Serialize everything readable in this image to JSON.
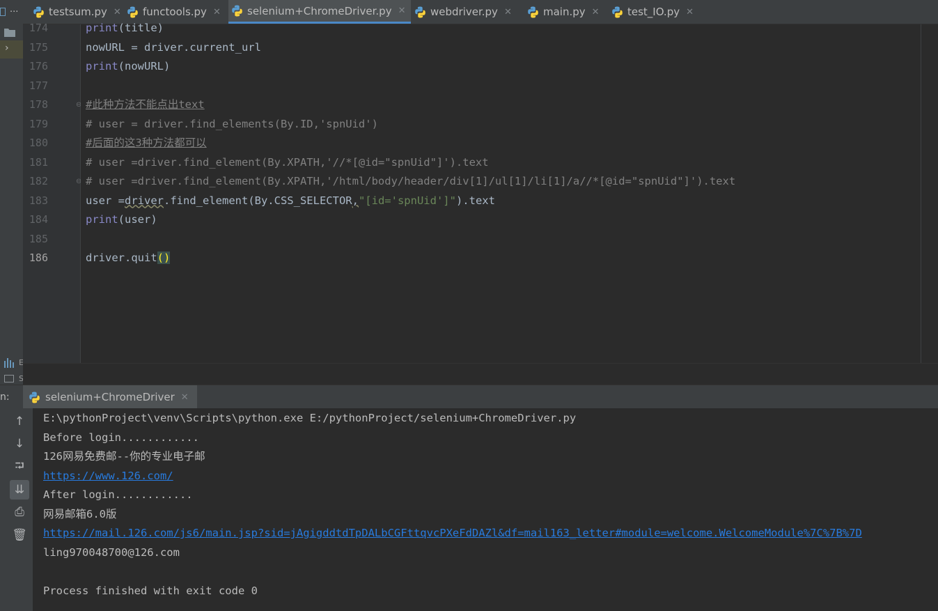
{
  "left_strip": {
    "project_label": "...",
    "bottom_letter_1": "E",
    "bottom_letter_2": "S"
  },
  "tabs": [
    {
      "label": "testsum.py",
      "active": false
    },
    {
      "label": "functools.py",
      "active": false
    },
    {
      "label": "selenium+ChromeDriver.py",
      "active": true
    },
    {
      "label": "webdriver.py",
      "active": false
    },
    {
      "label": "main.py",
      "active": false
    },
    {
      "label": "test_IO.py",
      "active": false
    }
  ],
  "tab_close_glyph": "✕",
  "editor": {
    "current_line": 186,
    "lines": [
      {
        "num": "174",
        "parts": [
          {
            "t": "print",
            "c": "builtin"
          },
          {
            "t": "(title)",
            "c": "text"
          }
        ]
      },
      {
        "num": "175",
        "parts": [
          {
            "t": "nowURL = driver.current_url",
            "c": "text"
          }
        ]
      },
      {
        "num": "176",
        "parts": [
          {
            "t": "print",
            "c": "builtin"
          },
          {
            "t": "(nowURL)",
            "c": "text"
          }
        ]
      },
      {
        "num": "177",
        "parts": []
      },
      {
        "num": "178",
        "parts": [
          {
            "t": "#此种方法不能点出text",
            "c": "comment-u"
          }
        ]
      },
      {
        "num": "179",
        "parts": [
          {
            "t": "# user = driver.find_elements(By.ID,'spnUid')",
            "c": "comment"
          }
        ]
      },
      {
        "num": "180",
        "parts": [
          {
            "t": "#后面的这3种方法都可以",
            "c": "comment-u"
          }
        ]
      },
      {
        "num": "181",
        "parts": [
          {
            "t": "# user =driver.find_element(By.XPATH,'//*[@id=\"spnUid\"]').text",
            "c": "comment"
          }
        ]
      },
      {
        "num": "182",
        "parts": [
          {
            "t": "# user =driver.find_element(By.XPATH,'/html/body/header/div[1]/ul[1]/li[1]/a//*[@id=\"spnUid\"]').text",
            "c": "comment"
          }
        ]
      },
      {
        "num": "183",
        "parts": [
          {
            "t": "user =",
            "c": "text"
          },
          {
            "t": "driver",
            "c": "wavy"
          },
          {
            "t": ".find_element(By.CSS_SELECTOR",
            "c": "text"
          },
          {
            "t": ",",
            "c": "wavy"
          },
          {
            "t": "\"[id='spnUid']\"",
            "c": "string"
          },
          {
            "t": ").text",
            "c": "text"
          }
        ]
      },
      {
        "num": "184",
        "parts": [
          {
            "t": "print",
            "c": "builtin"
          },
          {
            "t": "(user)",
            "c": "text"
          }
        ]
      },
      {
        "num": "185",
        "parts": []
      },
      {
        "num": "186",
        "parts": [
          {
            "t": "driver.quit",
            "c": "text"
          },
          {
            "t": "()",
            "c": "paren-hl"
          }
        ]
      }
    ]
  },
  "run_panel": {
    "label": "n:",
    "tab_label": "selenium+ChromeDriver",
    "output": [
      {
        "text": "E:\\pythonProject\\venv\\Scripts\\python.exe E:/pythonProject/selenium+ChromeDriver.py",
        "link": false
      },
      {
        "text": "Before login............",
        "link": false
      },
      {
        "text": "126网易免费邮--你的专业电子邮",
        "link": false
      },
      {
        "text": "https://www.126.com/",
        "link": true
      },
      {
        "text": "After login............",
        "link": false
      },
      {
        "text": "网易邮箱6.0版",
        "link": false
      },
      {
        "text": "https://mail.126.com/js6/main.jsp?sid=jAgigddtdTpDALbCGFttqvcPXeFdDAZl&df=mail163_letter#module=welcome.WelcomeModule%7C%7B%7D",
        "link": true
      },
      {
        "text": "ling970048700@126.com",
        "link": false
      },
      {
        "text": "",
        "link": false
      },
      {
        "text": "Process finished with exit code 0",
        "link": false
      }
    ],
    "tools": [
      {
        "name": "scroll-up-icon",
        "glyph": "↑",
        "active": false
      },
      {
        "name": "scroll-down-icon",
        "glyph": "↓",
        "active": false
      },
      {
        "name": "soft-wrap-icon",
        "glyph": "⮒",
        "active": false
      },
      {
        "name": "scroll-to-end-icon",
        "glyph": "⇊",
        "active": true
      },
      {
        "name": "print-icon",
        "glyph": "⎙",
        "active": false
      },
      {
        "name": "trash-icon",
        "glyph": "🗑",
        "active": false
      }
    ]
  },
  "colors": {
    "background": "#2b2b2b",
    "keyword_builtin": "#8888c6",
    "comment": "#808080",
    "string": "#6a8759",
    "link": "#287bde",
    "tab_active_underline": "#4a88c7"
  }
}
